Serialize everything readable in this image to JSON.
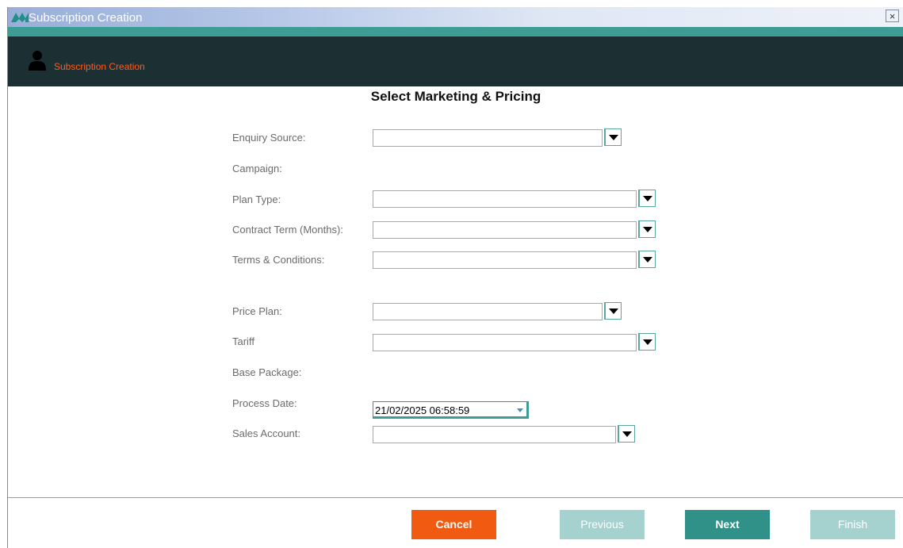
{
  "window": {
    "title": "Subscription Creation",
    "close_label": "×"
  },
  "header": {
    "breadcrumb": "Subscription Creation"
  },
  "page": {
    "title": "Select Marketing & Pricing"
  },
  "form": {
    "enquiry_source": {
      "label": "Enquiry Source:",
      "value": ""
    },
    "campaign": {
      "label": "Campaign:"
    },
    "plan_type": {
      "label": "Plan Type:",
      "value": ""
    },
    "contract_term": {
      "label": "Contract Term (Months):",
      "value": ""
    },
    "terms_conditions": {
      "label": "Terms & Conditions:",
      "value": ""
    },
    "price_plan": {
      "label": "Price Plan:",
      "value": ""
    },
    "tariff": {
      "label": "Tariff",
      "value": ""
    },
    "base_package": {
      "label": "Base Package:"
    },
    "process_date": {
      "label": "Process Date:",
      "value": "21/02/2025  06:58:59"
    },
    "sales_account": {
      "label": "Sales Account:",
      "value": ""
    }
  },
  "buttons": {
    "cancel": "Cancel",
    "previous": "Previous",
    "next": "Next",
    "finish": "Finish"
  },
  "colors": {
    "accent_orange": "#f15a11",
    "teal": "#2f9188",
    "teal_disabled": "#a5d2cf",
    "header_dark": "#1c3033"
  }
}
